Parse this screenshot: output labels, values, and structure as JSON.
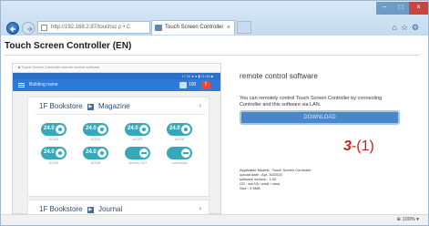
{
  "browser": {
    "address": "http://192.168.2.87/touchsc ρ • C",
    "tab_title": "Touch Screen Controller",
    "tab_close": "×",
    "zoom": "⊕ 100% ▾"
  },
  "page": {
    "title": "Touch Screen Controller (EN)"
  },
  "app_preview": {
    "topbar_text": "■ Touch Screen Controller  remote control software",
    "status_text": "17:00  ● ●  ▮ 11:44 ■",
    "header_label": "Building name",
    "count": "100",
    "alert": "!",
    "cards": [
      {
        "floor": "1F Bookstore",
        "room": "Magazine",
        "separator": "▶",
        "chevron": "›",
        "devices_row1": [
          {
            "temp": "24.0",
            "label": "AC001"
          },
          {
            "temp": "24.0",
            "label": "AC002"
          },
          {
            "temp": "24.0",
            "label": "AC003"
          },
          {
            "temp": "24.0",
            "label": "AC004"
          }
        ],
        "devices_row2": [
          {
            "temp": "24.0",
            "label": "AC005"
          },
          {
            "temp": "24.0",
            "label": "AC006"
          },
          {
            "label": "Security OUT"
          },
          {
            "label": "Luminaries"
          }
        ]
      },
      {
        "floor": "1F Bookstore",
        "room": "Journal",
        "separator": "▶",
        "chevron": "›"
      }
    ]
  },
  "info": {
    "heading": "remote control software",
    "description": "You can remotely control Touch Screen Controller by connecting Controller and this software via LAN.",
    "download_label": "DOWNLOAD",
    "step_number": "3",
    "step_suffix": "-(1)",
    "specs": [
      "Applicable Models : Touch Screen Controller",
      "upload date : Apr. 30/2015",
      "software version : 1.00",
      "OS : win7/8 / win8 / vista",
      "Size : 3.9MB"
    ]
  }
}
